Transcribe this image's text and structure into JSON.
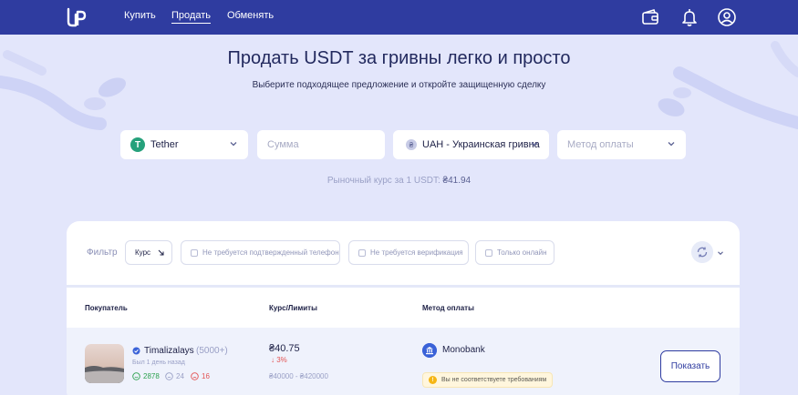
{
  "header": {
    "nav": [
      "Купить",
      "Продать",
      "Обменять"
    ],
    "active_index": 1,
    "icons": [
      "logo-icon",
      "wallet-icon",
      "bell-icon",
      "user-icon"
    ],
    "bar_color": "#2f3ca0"
  },
  "hero": {
    "title": "Продать USDT за гривны легко и просто",
    "subtitle": "Выберите подходящее предложение и откройте защищенную сделку"
  },
  "search": {
    "coin": {
      "letter": "T",
      "label": "Tether",
      "color": "#26a17b"
    },
    "amount_placeholder": "Сумма",
    "currency": {
      "label": "UAH - Украинская гривна"
    },
    "payment_placeholder": "Метод оплаты"
  },
  "rate": {
    "label": "Рыночный курс за 1 USDT:",
    "value": "₴41.94"
  },
  "filters": {
    "label": "Фильтр",
    "sort_label": "Курс",
    "checkboxes": [
      "Не требуется подтвержденный телефон",
      "Не требуется верификация",
      "Только онлайн"
    ]
  },
  "table": {
    "columns": [
      "Покупатель",
      "Курс/Лимиты",
      "Метод оплаты"
    ],
    "rows": [
      {
        "name": "Timalizalays",
        "deals": "(5000+)",
        "last_seen": "Был 1 день назад",
        "positive": "2878",
        "neutral": "24",
        "negative": "16",
        "price": "₴40.75",
        "change": "3%",
        "limits": "₴40000 - ₴420000",
        "bank": "Monobank",
        "warning": "Вы не соответствуете требованиям",
        "action": "Показать"
      }
    ]
  }
}
